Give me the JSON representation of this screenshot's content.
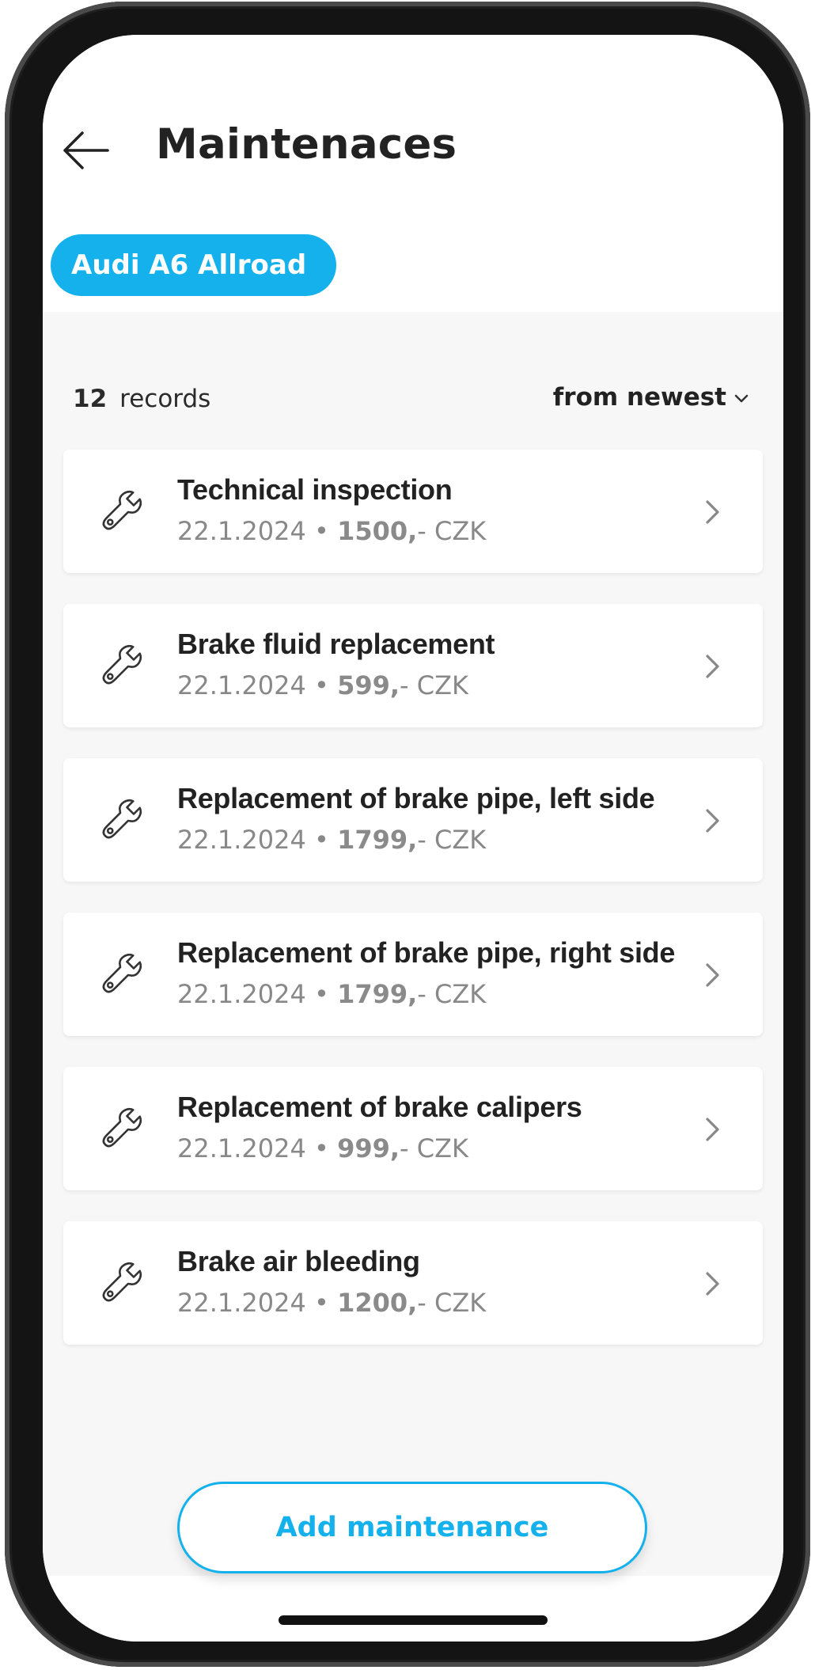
{
  "header": {
    "title": "Maintenaces"
  },
  "vehicle_chip": {
    "label": "Audi A6 Allroad"
  },
  "summary": {
    "count": "12",
    "records_label": "records",
    "sort_label": "from newest"
  },
  "records": [
    {
      "title": "Technical inspection",
      "date": "22.1.2024",
      "sep": " • ",
      "amount": "1500,",
      "currency": "- CZK"
    },
    {
      "title": "Brake fluid replacement",
      "date": "22.1.2024",
      "sep": " • ",
      "amount": "599,",
      "currency": "- CZK"
    },
    {
      "title": "Replacement of brake pipe, left side",
      "date": "22.1.2024",
      "sep": " • ",
      "amount": "1799,",
      "currency": "- CZK"
    },
    {
      "title": "Replacement of brake pipe, right side",
      "date": "22.1.2024",
      "sep": " • ",
      "amount": "1799,",
      "currency": "- CZK"
    },
    {
      "title": "Replacement of brake calipers",
      "date": "22.1.2024",
      "sep": " • ",
      "amount": "999,",
      "currency": "- CZK"
    },
    {
      "title": "Brake air bleeding",
      "date": "22.1.2024",
      "sep": " • ",
      "amount": "1200,",
      "currency": "- CZK"
    }
  ],
  "add_button": {
    "label": "Add maintenance"
  },
  "icons": {
    "back": "arrow-left-icon",
    "record": "wrench-icon",
    "open": "chevron-right-icon",
    "sort": "chevron-down-icon"
  },
  "colors": {
    "accent": "#14b1ec",
    "text_primary": "#222222",
    "text_muted": "#888888",
    "list_background": "#f7f7f7"
  }
}
